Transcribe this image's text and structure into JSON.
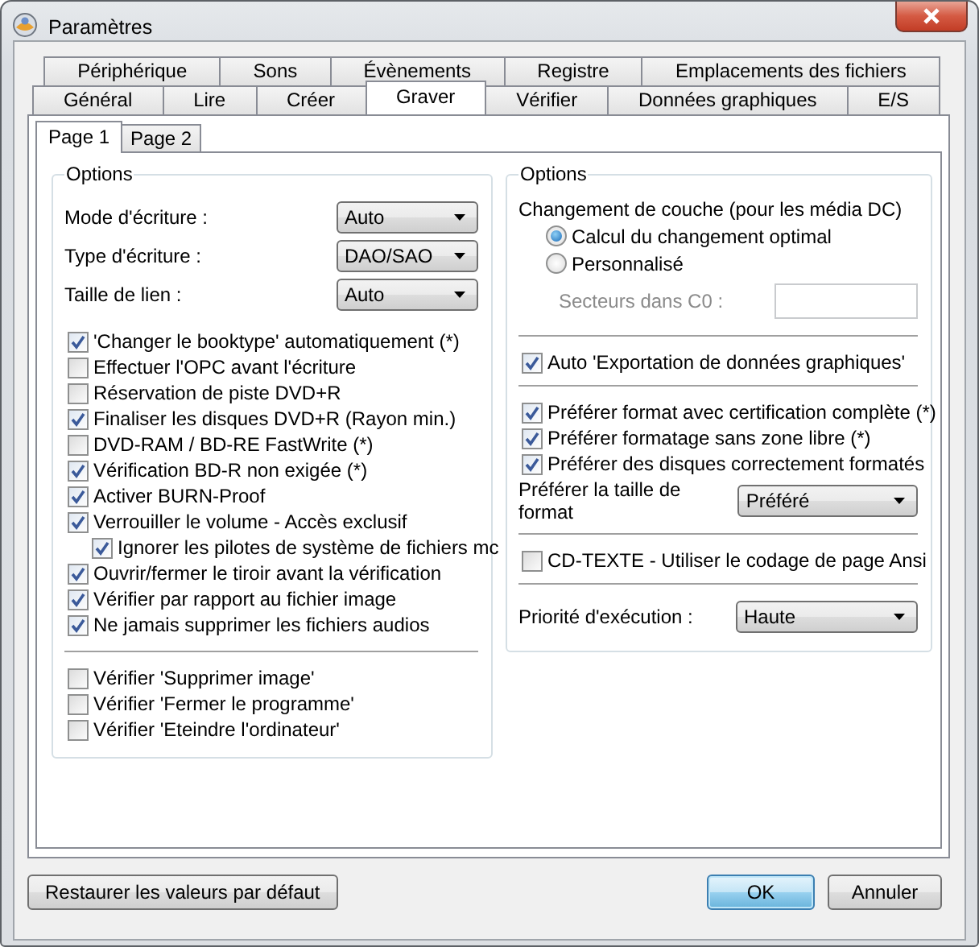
{
  "window": {
    "title": "Paramètres"
  },
  "tabs": [
    [
      {
        "label": "Périphérique",
        "selected": false
      },
      {
        "label": "Sons",
        "selected": false
      },
      {
        "label": "Évènements",
        "selected": false
      },
      {
        "label": "Registre",
        "selected": false
      },
      {
        "label": "Emplacements des fichiers",
        "selected": false
      }
    ],
    [
      {
        "label": "Général",
        "selected": false
      },
      {
        "label": "Lire",
        "selected": false
      },
      {
        "label": "Créer",
        "selected": false
      },
      {
        "label": "Graver",
        "selected": true
      },
      {
        "label": "Vérifier",
        "selected": false
      },
      {
        "label": "Données graphiques",
        "selected": false
      },
      {
        "label": "E/S",
        "selected": false
      }
    ]
  ],
  "subtabs": [
    {
      "label": "Page 1",
      "selected": true
    },
    {
      "label": "Page 2",
      "selected": false
    }
  ],
  "left_group": {
    "title": "Options",
    "fields": [
      {
        "label": "Mode d'écriture :",
        "value": "Auto"
      },
      {
        "label": "Type d'écriture :",
        "value": "DAO/SAO"
      },
      {
        "label": "Taille de lien :",
        "value": "Auto"
      }
    ],
    "checkboxes": [
      {
        "label": "'Changer le booktype' automatiquement (*)",
        "checked": true
      },
      {
        "label": "Effectuer l'OPC avant l'écriture",
        "checked": false
      },
      {
        "label": "Réservation de piste DVD+R",
        "checked": false
      },
      {
        "label": "Finaliser les disques DVD+R (Rayon min.)",
        "checked": true
      },
      {
        "label": "DVD-RAM / BD-RE FastWrite (*)",
        "checked": false
      },
      {
        "label": "Vérification BD-R non exigée (*)",
        "checked": true
      },
      {
        "label": "Activer BURN-Proof",
        "checked": true
      },
      {
        "label": "Verrouiller le volume - Accès exclusif",
        "checked": true,
        "children": [
          {
            "label": "Ignorer les pilotes de système de fichiers mc",
            "checked": true
          }
        ]
      },
      {
        "label": "Ouvrir/fermer le tiroir avant la vérification",
        "checked": true
      },
      {
        "label": "Vérifier par rapport au fichier image",
        "checked": true
      },
      {
        "label": "Ne jamais supprimer les fichiers audios",
        "checked": true
      }
    ],
    "verify_checkboxes": [
      {
        "label": "Vérifier 'Supprimer image'",
        "checked": false
      },
      {
        "label": "Vérifier 'Fermer le programme'",
        "checked": false
      },
      {
        "label": "Vérifier 'Eteindre l'ordinateur'",
        "checked": false
      }
    ]
  },
  "right_group": {
    "title": "Options",
    "layer_change": {
      "label": "Changement de couche (pour les média DC)",
      "options": [
        {
          "label": "Calcul du changement optimal",
          "selected": true
        },
        {
          "label": "Personnalisé",
          "selected": false
        }
      ],
      "sectors": {
        "label": "Secteurs dans C0 :",
        "disabled": true
      }
    },
    "auto_export": {
      "label": "Auto 'Exportation de données graphiques'",
      "checked": true
    },
    "format_checkboxes": [
      {
        "label": "Préférer format avec certification complète (*)",
        "checked": true
      },
      {
        "label": "Préférer formatage sans zone libre (*)",
        "checked": true
      },
      {
        "label": "Préférer des disques correctement formatés",
        "checked": true
      }
    ],
    "format_size": {
      "label": "Préférer la taille de format",
      "value": "Préféré"
    },
    "cd_text": {
      "label": "CD-TEXTE - Utiliser le codage de page Ansi",
      "checked": false
    },
    "priority": {
      "label": "Priorité d'exécution :",
      "value": "Haute"
    }
  },
  "buttons": {
    "restore": "Restaurer les valeurs par défaut",
    "ok": "OK",
    "cancel": "Annuler"
  }
}
